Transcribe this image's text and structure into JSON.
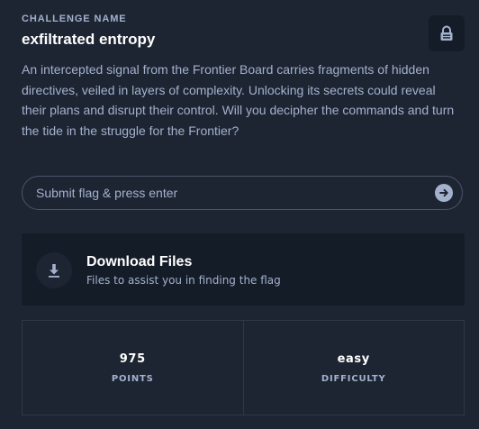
{
  "challenge": {
    "label": "CHALLENGE NAME",
    "title": "exfiltrated entropy",
    "description": "An intercepted signal from the Frontier Board carries fragments of hidden directives, veiled in layers of complexity. Unlocking its secrets could reveal their plans and disrupt their control. Will you decipher the commands and turn the tide in the struggle for the Frontier?",
    "lock_icon": "lock-icon"
  },
  "flag_input": {
    "placeholder": "Submit flag & press enter",
    "value": "",
    "submit_icon": "arrow-right-circle-icon"
  },
  "download": {
    "title": "Download Files",
    "subtitle": "Files to assist you in finding the flag",
    "icon": "download-icon"
  },
  "stats": {
    "points_value": "975",
    "points_label": "POINTS",
    "difficulty_value": "easy",
    "difficulty_label": "DIFFICULTY"
  },
  "colors": {
    "background": "#1d2533",
    "card": "#141c28",
    "text_muted": "#a4b1cd",
    "border": "#4b5568"
  }
}
